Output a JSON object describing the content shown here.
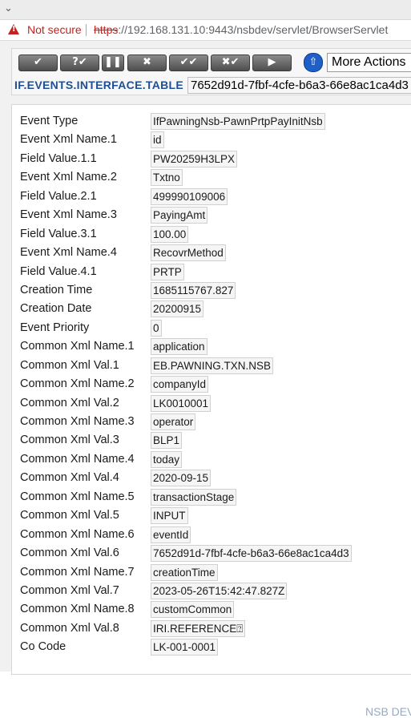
{
  "browser": {
    "not_secure": "Not secure",
    "url_scheme": "https",
    "url_rest": "://192.168.131.10:9443/nsbdev/servlet/BrowserServlet",
    "download_icon": "chevron-down-icon"
  },
  "toolbar": {
    "buttons": [
      {
        "name": "validate-button",
        "glyph": "✔"
      },
      {
        "name": "query-button",
        "glyph": "?✔"
      },
      {
        "name": "hold-button",
        "glyph": "❚❚"
      },
      {
        "name": "delete-button",
        "glyph": "✖"
      },
      {
        "name": "authorise-button",
        "glyph": "✔✔"
      },
      {
        "name": "reverse-button",
        "glyph": "✖✔"
      },
      {
        "name": "next-button",
        "glyph": "▶"
      }
    ],
    "more_actions": "More Actions",
    "accent": "#1f5fc8"
  },
  "header": {
    "title": "IF.EVENTS.INTERFACE.TABLE",
    "record_id": "7652d91d-7fbf-4cfe-b6a3-66e8ac1ca4d3"
  },
  "fields": [
    {
      "label": "Event Type",
      "value": "IfPawningNsb-PawnPrtpPayInitNsb"
    },
    {
      "label": "Event Xml Name.1",
      "value": "id"
    },
    {
      "label": "Field Value.1.1",
      "value": "PW20259H3LPX"
    },
    {
      "label": "Event Xml Name.2",
      "value": "Txtno"
    },
    {
      "label": "Field Value.2.1",
      "value": "499990109006"
    },
    {
      "label": "Event Xml Name.3",
      "value": "PayingAmt"
    },
    {
      "label": "Field Value.3.1",
      "value": "100.00"
    },
    {
      "label": "Event Xml Name.4",
      "value": "RecovrMethod"
    },
    {
      "label": "Field Value.4.1",
      "value": "PRTP"
    },
    {
      "label": "Creation Time",
      "value": "1685115767.827"
    },
    {
      "label": "Creation Date",
      "value": "20200915"
    },
    {
      "label": "Event Priority",
      "value": "0"
    },
    {
      "label": "Common Xml Name.1",
      "value": "application"
    },
    {
      "label": "Common Xml Val.1",
      "value": "EB.PAWNING.TXN.NSB"
    },
    {
      "label": "Common Xml Name.2",
      "value": "companyId"
    },
    {
      "label": "Common Xml Val.2",
      "value": "LK0010001"
    },
    {
      "label": "Common Xml Name.3",
      "value": "operator"
    },
    {
      "label": "Common Xml Val.3",
      "value": "BLP1"
    },
    {
      "label": "Common Xml Name.4",
      "value": "today"
    },
    {
      "label": "Common Xml Val.4",
      "value": "2020-09-15"
    },
    {
      "label": "Common Xml Name.5",
      "value": "transactionStage"
    },
    {
      "label": "Common Xml Val.5",
      "value": "INPUT"
    },
    {
      "label": "Common Xml Name.6",
      "value": "eventId"
    },
    {
      "label": "Common Xml Val.6",
      "value": "7652d91d-7fbf-4cfe-b6a3-66e8ac1ca4d3"
    },
    {
      "label": "Common Xml Name.7",
      "value": "creationTime"
    },
    {
      "label": "Common Xml Val.7",
      "value": "2023-05-26T15:42:47.827Z"
    },
    {
      "label": "Common Xml Name.8",
      "value": "customCommon"
    },
    {
      "label": "Common Xml Val.8",
      "value": "IRI.REFERENCE⍰"
    },
    {
      "label": "Co Code",
      "value": "LK-001-0001"
    }
  ],
  "footer": "NSB DEV"
}
